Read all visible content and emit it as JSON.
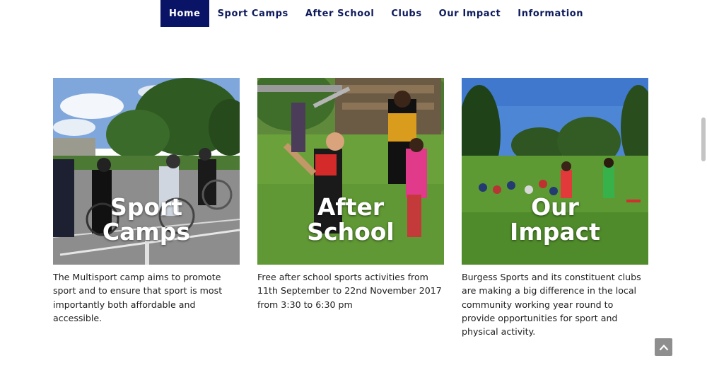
{
  "nav": {
    "items": [
      {
        "label": "Home",
        "active": true
      },
      {
        "label": "Sport Camps",
        "active": false
      },
      {
        "label": "After School",
        "active": false
      },
      {
        "label": "Clubs",
        "active": false
      },
      {
        "label": "Our Impact",
        "active": false
      },
      {
        "label": "Information",
        "active": false
      }
    ],
    "active_color": "#0a1466",
    "text_color": "#0d1a5c"
  },
  "cards": [
    {
      "title_line1": "Sport",
      "title_line2": "Camps",
      "description": "The Multisport camp aims to promote sport and to ensure that sport is most importantly both affordable and accessible."
    },
    {
      "title_line1": "After",
      "title_line2": "School",
      "description": "Free after school sports activities from 11th September to 22nd November 2017 from 3:30 to 6:30 pm"
    },
    {
      "title_line1": "Our",
      "title_line2": "Impact",
      "description": "Burgess Sports and its constituent clubs are making a big difference in the local community working year round to provide opportunities for sport and physical activity."
    }
  ],
  "scroll_to_top": {
    "icon": "chevron-up-icon"
  }
}
